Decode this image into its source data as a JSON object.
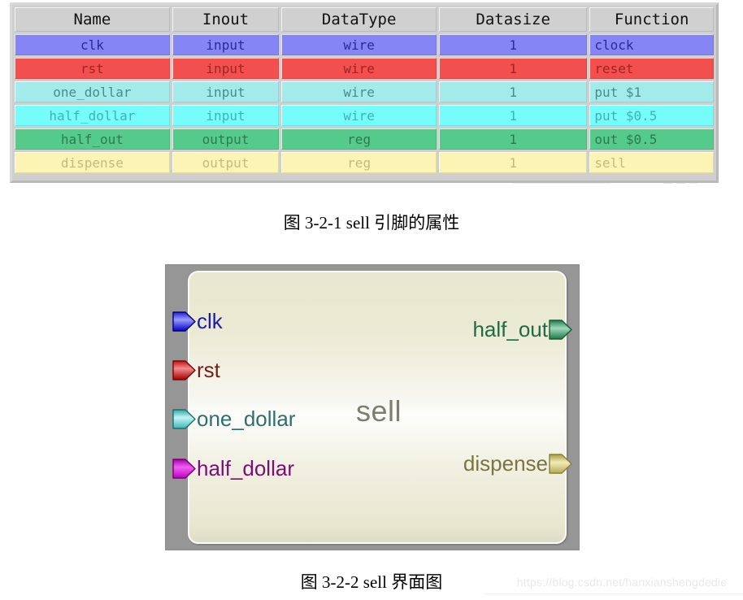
{
  "document": {
    "watermark_url": "https://blog.csdn.net/hanxianshengdedie"
  },
  "pin_table": {
    "headers": [
      "Name",
      "Inout",
      "DataType",
      "Datasize",
      "Function"
    ],
    "rows": [
      {
        "name": "clk",
        "inout": "input",
        "datatype": "wire",
        "datasize": "1",
        "function": "clock",
        "fill": "#8585f5",
        "text": "#2a2a9c"
      },
      {
        "name": "rst",
        "inout": "input",
        "datatype": "wire",
        "datasize": "1",
        "function": "reset",
        "fill": "#f44f4f",
        "text": "#9c2626"
      },
      {
        "name": "one_dollar",
        "inout": "input",
        "datatype": "wire",
        "datasize": "1",
        "function": "put $1",
        "fill": "#a3ebeb",
        "text": "#4b8b8b"
      },
      {
        "name": "half_dollar",
        "inout": "input",
        "datatype": "wire",
        "datasize": "1",
        "function": "put $0.5",
        "fill": "#77fcfc",
        "text": "#3fb3b3"
      },
      {
        "name": "half_out",
        "inout": "output",
        "datatype": "reg",
        "datasize": "1",
        "function": "out $0.5",
        "fill": "#54cb8a",
        "text": "#2d7a52"
      },
      {
        "name": "dispense",
        "inout": "output",
        "datatype": "reg",
        "datasize": "1",
        "function": "sell",
        "fill": "#fbf4b4",
        "text": "#c3bb7a"
      }
    ]
  },
  "caption_1": "图 3-2-1 sell 引脚的属性",
  "caption_2": "图 3-2-2 sell 界面图",
  "schematic": {
    "module_name": "sell",
    "inputs": [
      {
        "label": "clk",
        "icon": "input-port-arrow-icon",
        "color_light": "#9a9aff",
        "color_dark": "#0000c8",
        "label_color": "#1b1bb4"
      },
      {
        "label": "rst",
        "icon": "input-port-arrow-icon",
        "color_light": "#e08080",
        "color_dark": "#c00000",
        "label_color": "#7a1b1b"
      },
      {
        "label": "one_dollar",
        "icon": "input-port-arrow-icon",
        "color_light": "#b8f0f0",
        "color_dark": "#20a0a0",
        "label_color": "#2d6f6f"
      },
      {
        "label": "half_dollar",
        "icon": "input-port-arrow-icon",
        "color_light": "#e060e0",
        "color_dark": "#b000b0",
        "label_color": "#7a0f7a"
      }
    ],
    "outputs": [
      {
        "label": "half_out",
        "icon": "output-port-arrow-icon",
        "color_light": "#a8e0c0",
        "color_dark": "#1f8a52",
        "label_color": "#1f6b45"
      },
      {
        "label": "dispense",
        "icon": "output-port-arrow-icon",
        "color_light": "#f5f0b8",
        "color_dark": "#b0a850",
        "label_color": "#7a7540"
      }
    ]
  }
}
